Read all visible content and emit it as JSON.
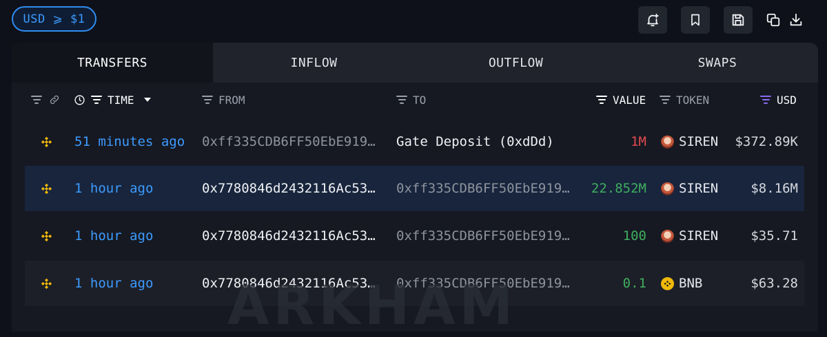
{
  "filter": {
    "usd_label": "USD ⩾ $1"
  },
  "toolbar": {
    "icons": [
      "bell-plus-icon",
      "bookmark-icon",
      "save-icon",
      "copy-icon",
      "download-icon"
    ]
  },
  "tabs": [
    {
      "label": "TRANSFERS",
      "active": true
    },
    {
      "label": "INFLOW",
      "active": false
    },
    {
      "label": "OUTFLOW",
      "active": false
    },
    {
      "label": "SWAPS",
      "active": false
    }
  ],
  "columns": {
    "time": "TIME",
    "from": "FROM",
    "to": "TO",
    "value": "VALUE",
    "token": "TOKEN",
    "usd": "USD"
  },
  "rows": [
    {
      "chain": "bnb-chain-icon",
      "time": "51 minutes ago",
      "from": "0xff335CDB6FF50EbE919…",
      "to": "Gate Deposit (0xdDd)",
      "value": "1M",
      "token": "SIREN",
      "usd": "$372.89K"
    },
    {
      "chain": "bnb-chain-icon",
      "time": "1 hour ago",
      "from": "0x7780846d2432116Ac53…",
      "to": "0xff335CDB6FF50EbE919…",
      "value": "22.852M",
      "token": "SIREN",
      "usd": "$8.16M"
    },
    {
      "chain": "bnb-chain-icon",
      "time": "1 hour ago",
      "from": "0x7780846d2432116Ac53…",
      "to": "0xff335CDB6FF50EbE919…",
      "value": "100",
      "token": "SIREN",
      "usd": "$35.71"
    },
    {
      "chain": "bnb-chain-icon",
      "time": "1 hour ago",
      "from": "0x7780846d2432116Ac53…",
      "to": "0xff335CDB6FF50EbE919…",
      "value": "0.1",
      "token": "BNB",
      "usd": "$63.28"
    }
  ],
  "watermark": "ARKHAM",
  "colors": {
    "accent": "#3d9bff",
    "negative": "#e24a50",
    "positive": "#3fae5e",
    "chain": "#f0b90b"
  }
}
